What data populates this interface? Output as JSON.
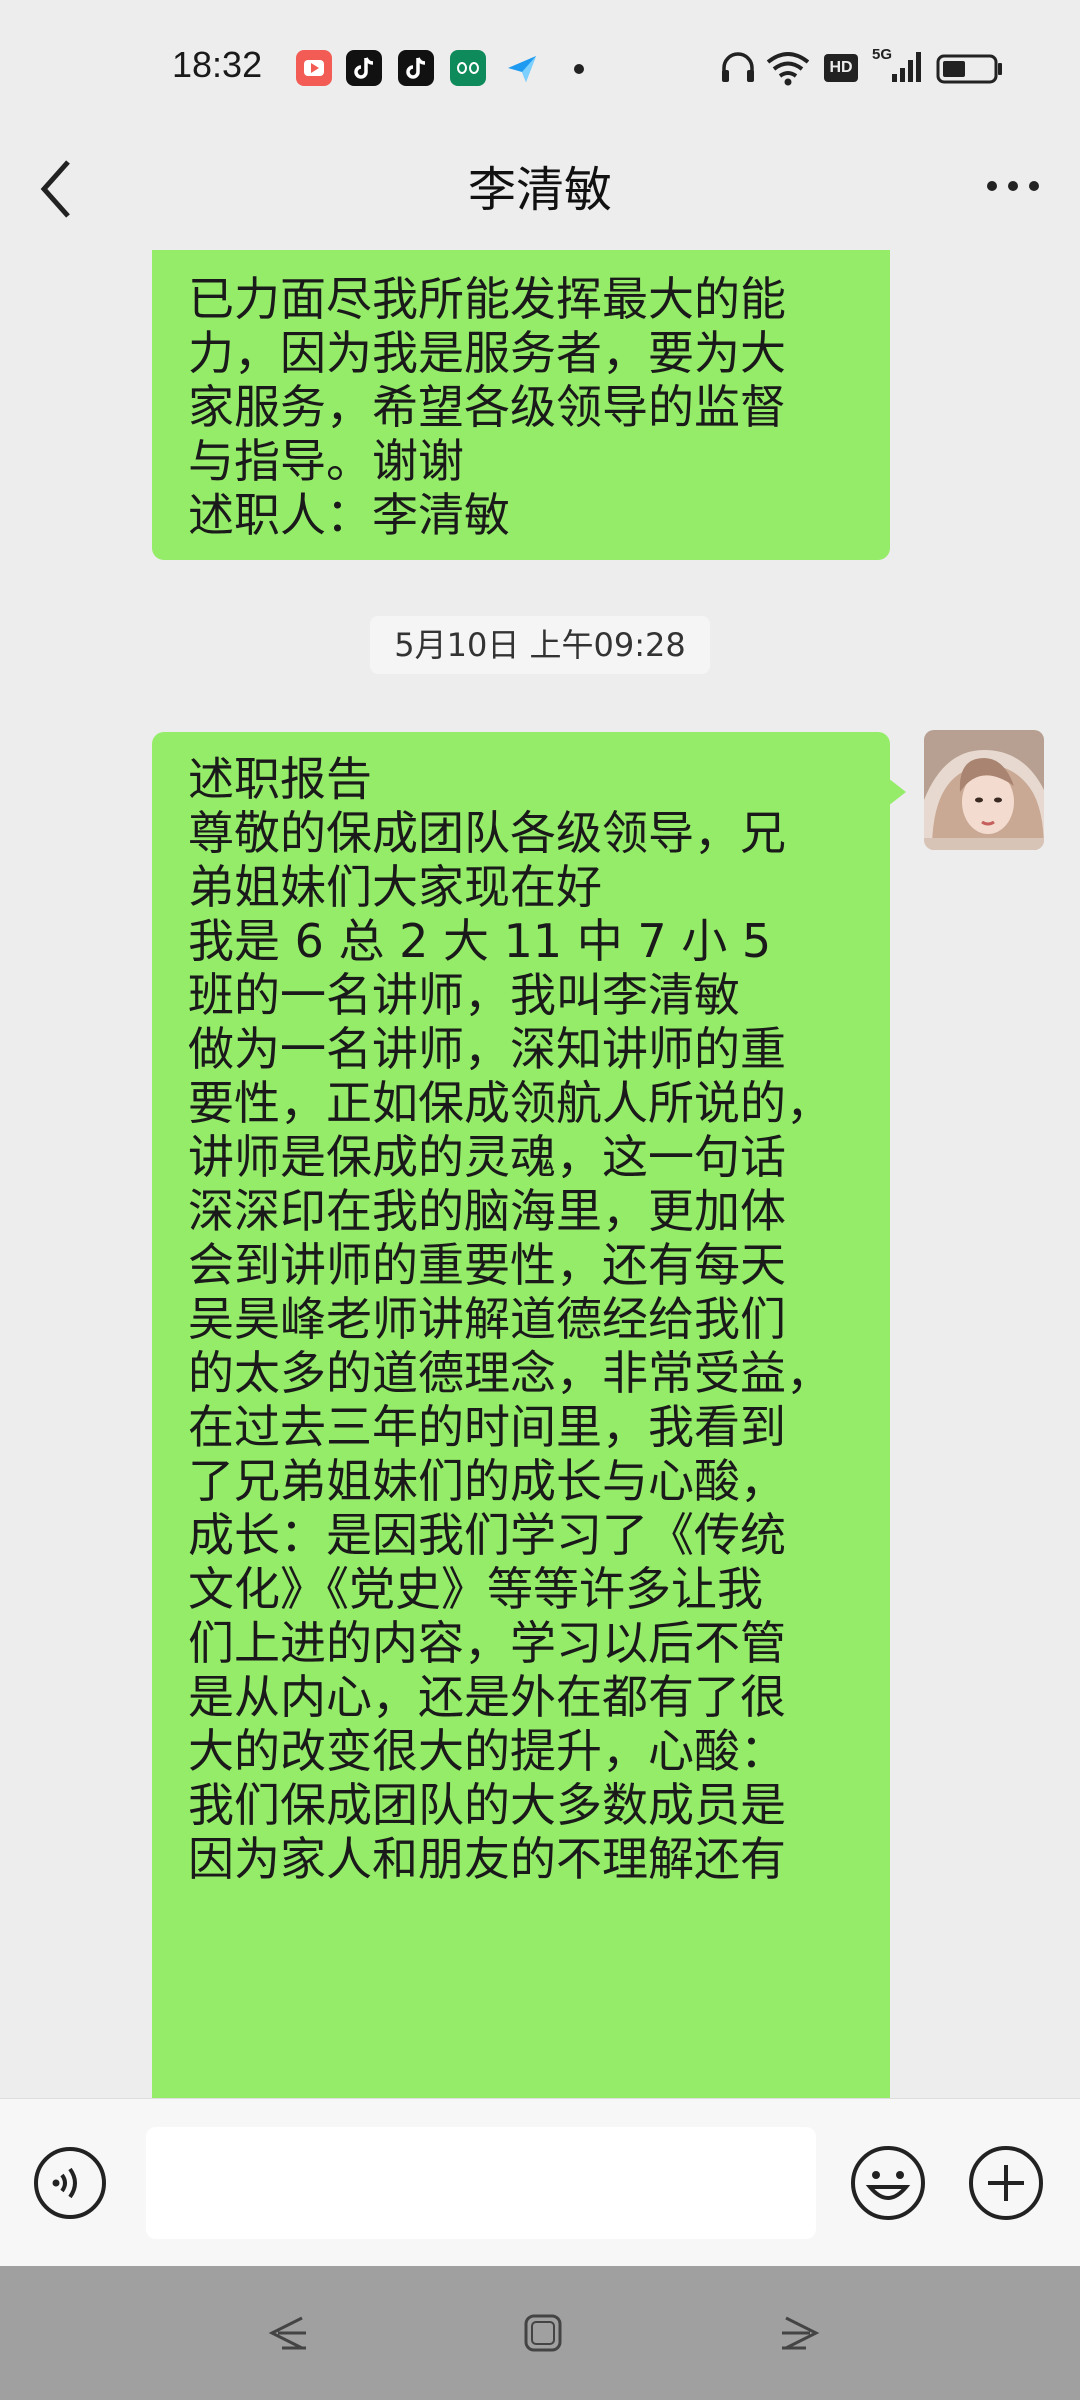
{
  "status_bar": {
    "time": "18:32",
    "app_icons": [
      "video-app-icon",
      "tiktok-icon",
      "tiktok-icon",
      "oppo-app-icon",
      "send-app-icon"
    ],
    "system_icons": [
      "headphone-icon",
      "wifi-icon",
      "hd-icon",
      "signal-5g-icon",
      "battery-icon"
    ],
    "hd_label": "HD",
    "network_label": "5G"
  },
  "header": {
    "title": "李清敏",
    "back_icon": "chevron-left-icon",
    "more_icon": "more-dots-icon"
  },
  "messages": [
    {
      "type": "outgoing",
      "text": "已力面尽我所能发挥最大的能\n力，因为我是服务者，要为大\n家服务，希望各级领导的监督\n与指导。谢谢\n述职人：李清敏"
    },
    {
      "type": "timestamp",
      "text": "5月10日 上午09:28"
    },
    {
      "type": "outgoing",
      "text": "述职报告\n尊敬的保成团队各级领导，兄\n弟姐妹们大家现在好\n我是 6 总 2 大 11 中 7 小 5\n班的一名讲师，我叫李清敏\n做为一名讲师，深知讲师的重\n要性，正如保成领航人所说的，\n讲师是保成的灵魂，这一句话\n深深印在我的脑海里，更加体\n会到讲师的重要性，还有每天\n吴昊峰老师讲解道德经给我们\n的太多的道德理念，非常受益，\n在过去三年的时间里，我看到\n了兄弟姐妹们的成长与心酸，\n成长：是因我们学习了《传统\n文化》《党史》等等许多让我\n们上进的内容，学习以后不管\n是从内心，还是外在都有了很\n大的改变很大的提升，心酸：\n我们保成团队的大多数成员是\n因为家人和朋友的不理解还有"
    }
  ],
  "input_bar": {
    "voice_icon": "voice-icon",
    "input_placeholder": "",
    "emoji_icon": "emoji-icon",
    "plus_icon": "plus-icon"
  },
  "nav_bar": {
    "icons": [
      "nav-back-icon",
      "nav-home-icon",
      "nav-recent-icon"
    ]
  },
  "colors": {
    "background": "#ededed",
    "bubble_green": "#95ec69",
    "input_bar_bg": "#f7f7f7",
    "nav_bar_bg": "#a0a0a0"
  }
}
